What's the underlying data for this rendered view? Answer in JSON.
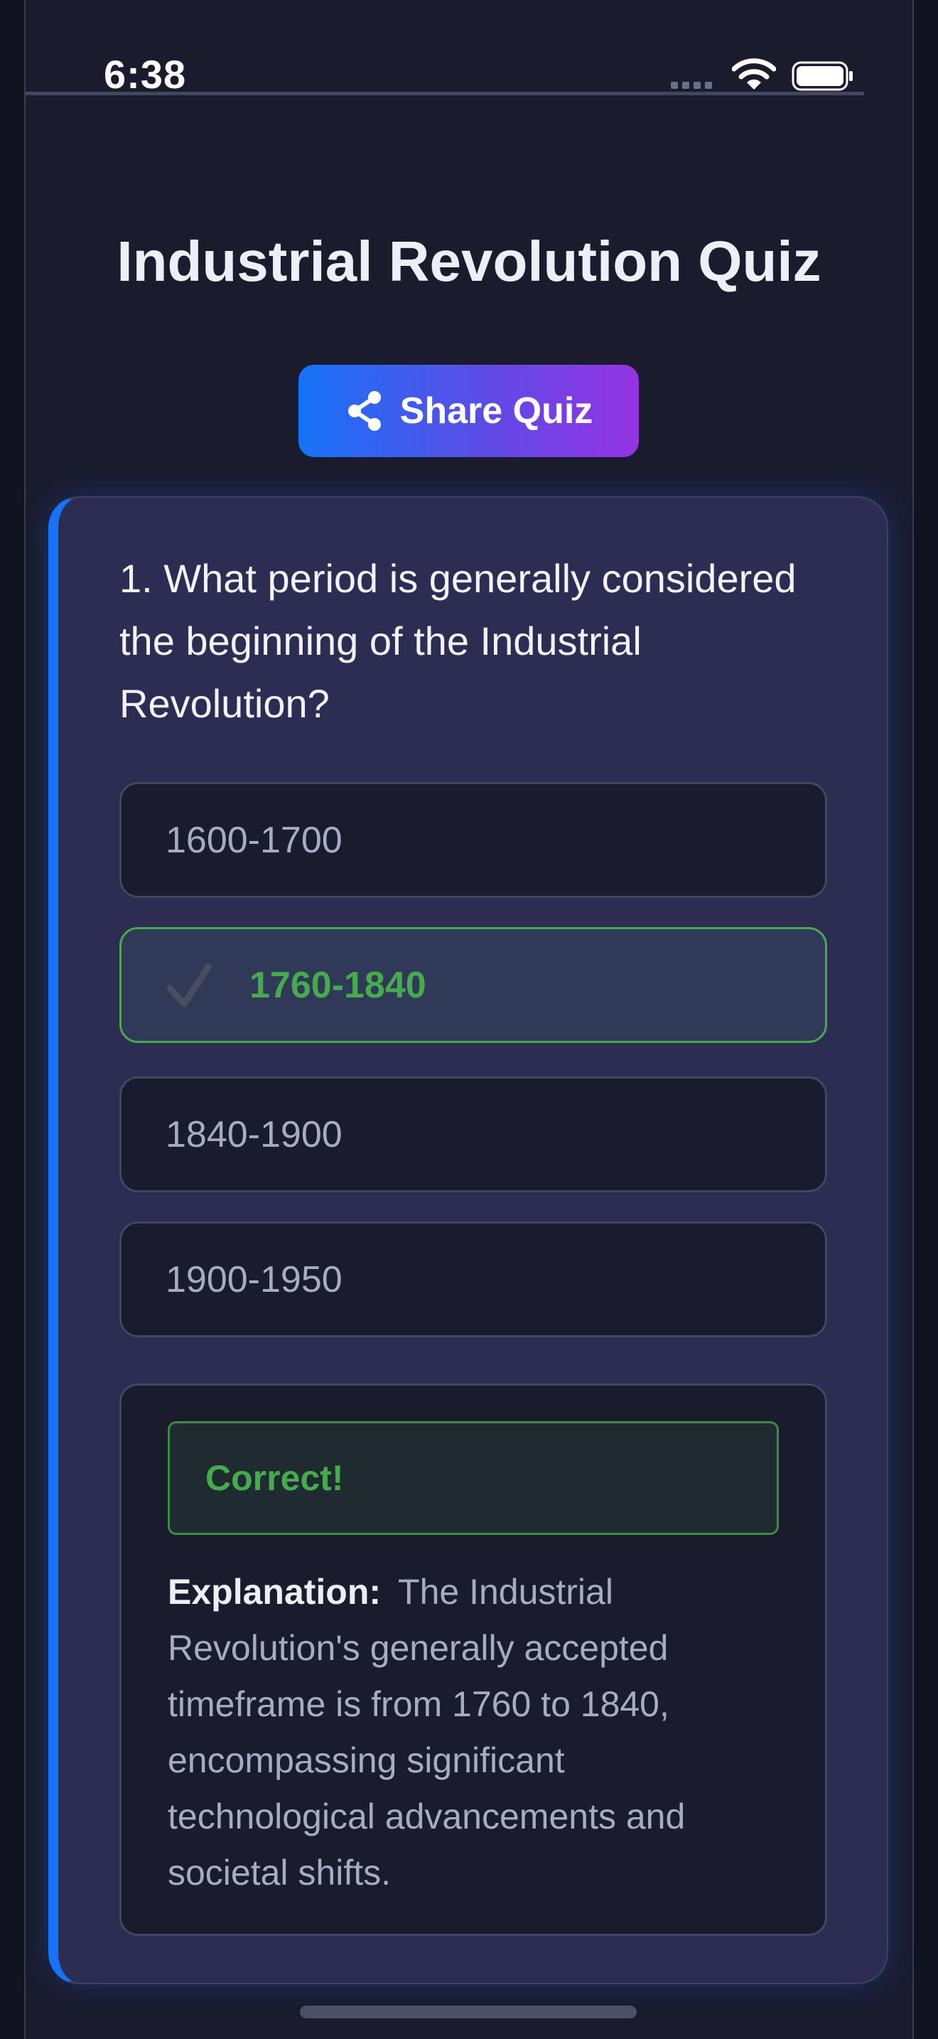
{
  "status_bar": {
    "time": "6:38",
    "icons": [
      "signal-dots-icon",
      "wifi-icon",
      "battery-icon"
    ]
  },
  "quiz": {
    "title": "Industrial Revolution Quiz",
    "share_label": "Share Quiz",
    "share_icon": "share-icon"
  },
  "question": {
    "text": "1. What period is generally considered the beginning of the Industrial Revolution?",
    "options": [
      {
        "label": "1600-1700",
        "state": "default"
      },
      {
        "label": "1760-1840",
        "state": "correct-selected",
        "icon": "checkmark-icon"
      },
      {
        "label": "1840-1900",
        "state": "default"
      },
      {
        "label": "1900-1950",
        "state": "default"
      }
    ]
  },
  "result": {
    "status": "Correct!",
    "explanation_label": "Explanation:",
    "explanation_text": "The Industrial Revolution's generally accepted timeframe is from 1760 to 1840, encompassing significant technological advancements and societal shifts."
  },
  "colors": {
    "background": "#1a1b2d",
    "card": "#2d2c52",
    "accent_blue": "#1673f7",
    "accent_purple": "#9533e2",
    "correct_green": "#46ab4c",
    "muted_text": "#a9acc0"
  }
}
